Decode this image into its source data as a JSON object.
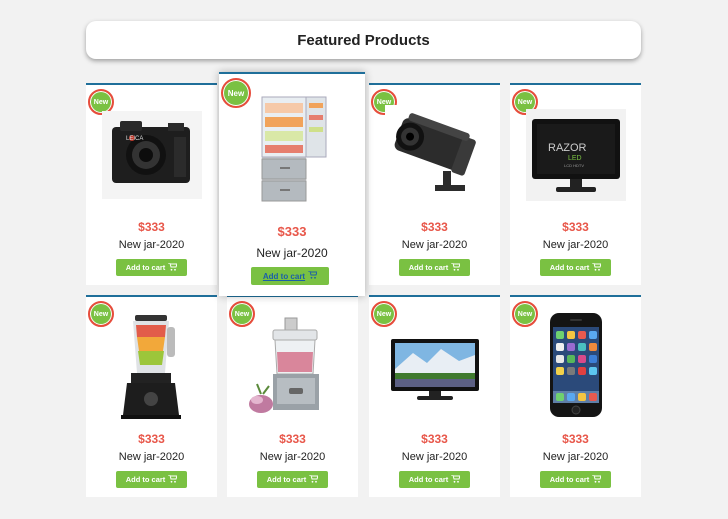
{
  "header": {
    "title": "Featured Products"
  },
  "products": [
    {
      "badge": "New",
      "price": "$333",
      "name": "New jar-2020",
      "cta": "Add to cart",
      "icon": "camera"
    },
    {
      "badge": "New",
      "price": "$333",
      "name": "New jar-2020",
      "cta": "Add to cart",
      "icon": "refrigerator"
    },
    {
      "badge": "New",
      "price": "$333",
      "name": "New jar-2020",
      "cta": "Add to cart",
      "icon": "security-camera"
    },
    {
      "badge": "New",
      "price": "$333",
      "name": "New jar-2020",
      "cta": "Add to cart",
      "icon": "tv-razor",
      "brand_text": "RAZOR",
      "brand_sub": "LED",
      "brand_sub2": "LCD HDTV"
    },
    {
      "badge": "New",
      "price": "$333",
      "name": "New jar-2020",
      "cta": "Add to cart",
      "icon": "blender"
    },
    {
      "badge": "New",
      "price": "$333",
      "name": "New jar-2020",
      "cta": "Add to cart",
      "icon": "food-processor"
    },
    {
      "badge": "New",
      "price": "$333",
      "name": "New jar-2020",
      "cta": "Add to cart",
      "icon": "tv-landscape"
    },
    {
      "badge": "New",
      "price": "$333",
      "name": "New jar-2020",
      "cta": "Add to cart",
      "icon": "smartphone"
    }
  ],
  "colors": {
    "accent": "#7ac142",
    "price": "#e8574a",
    "border": "#1f6f9a",
    "badge_ring": "#e74c3c"
  }
}
